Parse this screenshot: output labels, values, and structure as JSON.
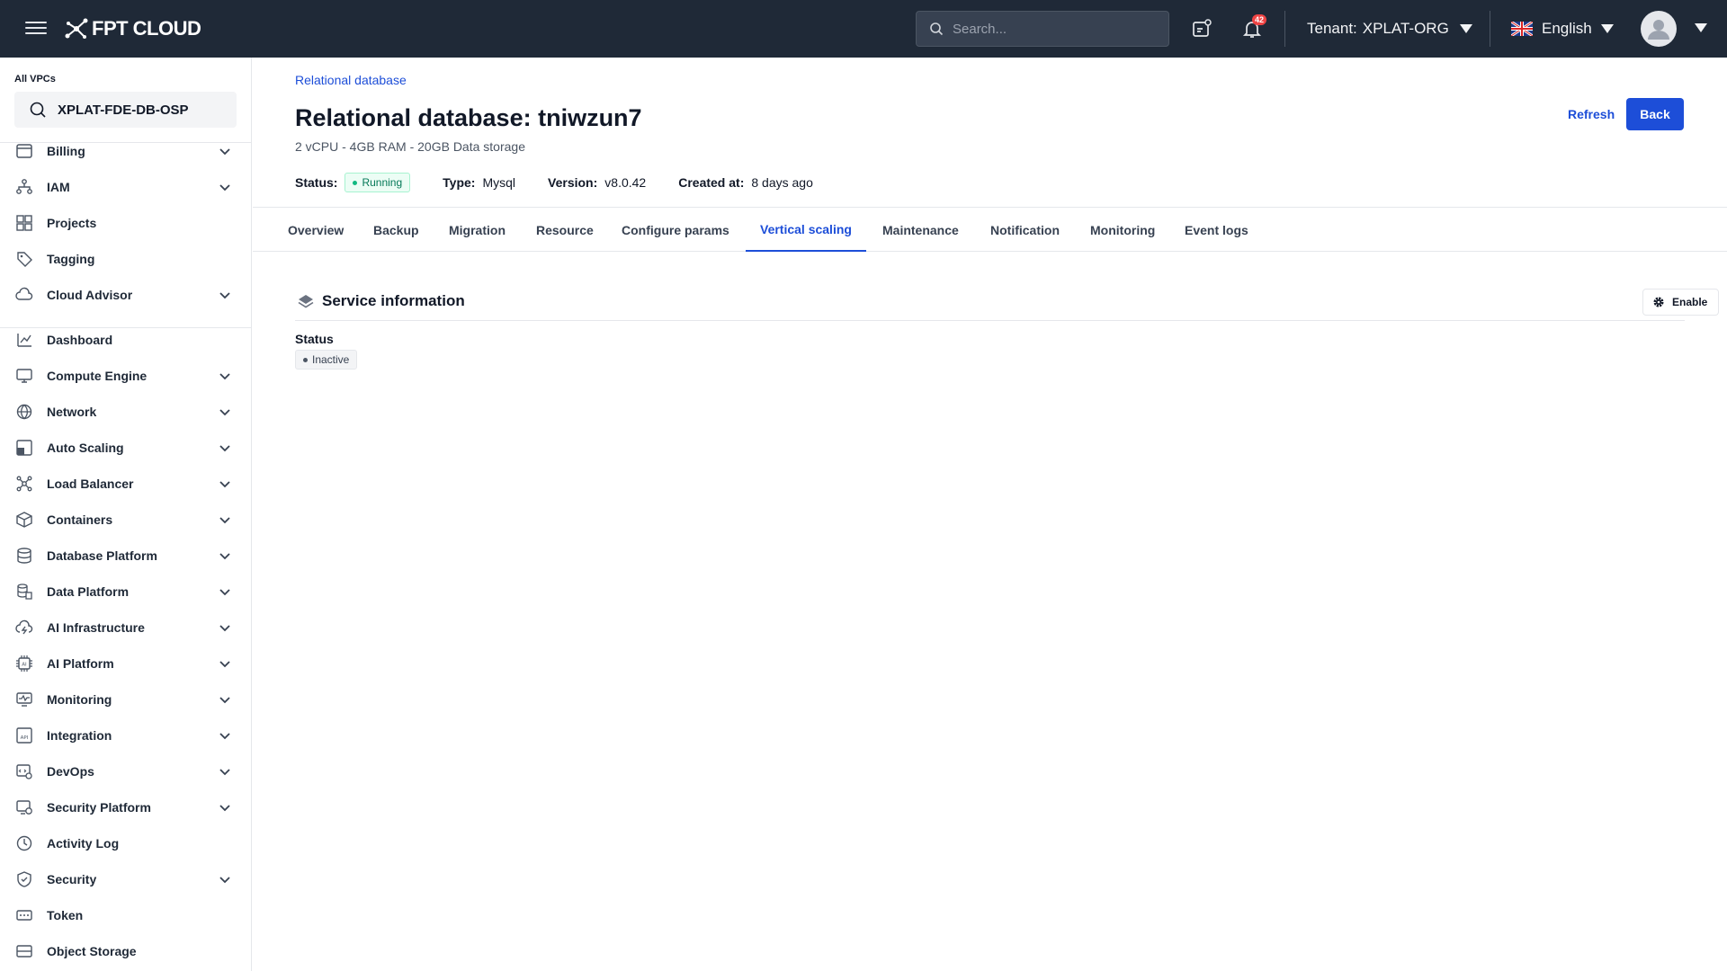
{
  "header": {
    "logo_text": "FPT CLOUD",
    "search_placeholder": "Search...",
    "notification_count": "42",
    "tenant_label": "Tenant:",
    "tenant_value": "XPLAT-ORG",
    "language": "English"
  },
  "sidebar": {
    "vpc_label": "All VPCs",
    "vpc_name": "XPLAT-FDE-DB-OSP",
    "items": [
      {
        "label": "Billing",
        "icon": "billing-icon",
        "expandable": true
      },
      {
        "label": "IAM",
        "icon": "iam-icon",
        "expandable": true
      },
      {
        "label": "Projects",
        "icon": "projects-icon",
        "expandable": false
      },
      {
        "label": "Tagging",
        "icon": "tag-icon",
        "expandable": false
      },
      {
        "label": "Cloud Advisor",
        "icon": "cloud-advisor-icon",
        "expandable": true
      },
      {
        "label": "Dashboard",
        "icon": "dashboard-icon",
        "expandable": false
      },
      {
        "label": "Compute Engine",
        "icon": "monitor-icon",
        "expandable": true
      },
      {
        "label": "Network",
        "icon": "network-icon",
        "expandable": true
      },
      {
        "label": "Auto Scaling",
        "icon": "auto-scaling-icon",
        "expandable": true
      },
      {
        "label": "Load Balancer",
        "icon": "load-balancer-icon",
        "expandable": true
      },
      {
        "label": "Containers",
        "icon": "containers-icon",
        "expandable": true
      },
      {
        "label": "Database Platform",
        "icon": "database-icon",
        "expandable": true
      },
      {
        "label": "Data Platform",
        "icon": "data-platform-icon",
        "expandable": true
      },
      {
        "label": "AI Infrastructure",
        "icon": "ai-infrastructure-icon",
        "expandable": true
      },
      {
        "label": "AI Platform",
        "icon": "ai-platform-icon",
        "expandable": true
      },
      {
        "label": "Monitoring",
        "icon": "monitoring-icon",
        "expandable": true
      },
      {
        "label": "Integration",
        "icon": "api-icon",
        "expandable": true
      },
      {
        "label": "DevOps",
        "icon": "devops-icon",
        "expandable": true
      },
      {
        "label": "Security Platform",
        "icon": "security-platform-icon",
        "expandable": true
      },
      {
        "label": "Activity Log",
        "icon": "clock-icon",
        "expandable": false
      },
      {
        "label": "Security",
        "icon": "shield-icon",
        "expandable": true
      },
      {
        "label": "Token",
        "icon": "token-icon",
        "expandable": false
      },
      {
        "label": "Object Storage",
        "icon": "storage-icon",
        "expandable": false
      }
    ]
  },
  "page": {
    "breadcrumb": "Relational database",
    "title": "Relational database: tniwzun7",
    "specs": "2 vCPU - 4GB RAM - 20GB Data storage",
    "status_label": "Status:",
    "status_value": "Running",
    "type_label": "Type:",
    "type_value": "Mysql",
    "version_label": "Version:",
    "version_value": "v8.0.42",
    "created_label": "Created at:",
    "created_value": "8 days ago",
    "refresh_label": "Refresh",
    "back_label": "Back"
  },
  "tabs": [
    {
      "label": "Overview",
      "active": false
    },
    {
      "label": "Backup",
      "active": false
    },
    {
      "label": "Migration",
      "active": false
    },
    {
      "label": "Resource",
      "active": false
    },
    {
      "label": "Configure params",
      "active": false
    },
    {
      "label": "Vertical scaling",
      "active": true
    },
    {
      "label": "Maintenance",
      "active": false
    },
    {
      "label": "Notification",
      "active": false
    },
    {
      "label": "Monitoring",
      "active": false
    },
    {
      "label": "Event logs",
      "active": false
    }
  ],
  "service": {
    "title": "Service information",
    "enable_label": "Enable",
    "status_label": "Status",
    "status_value": "Inactive"
  },
  "colors": {
    "topbar": "#1f2937",
    "accent": "#1d4ed8",
    "running": "#10b981",
    "inactive": "#6b7280"
  }
}
